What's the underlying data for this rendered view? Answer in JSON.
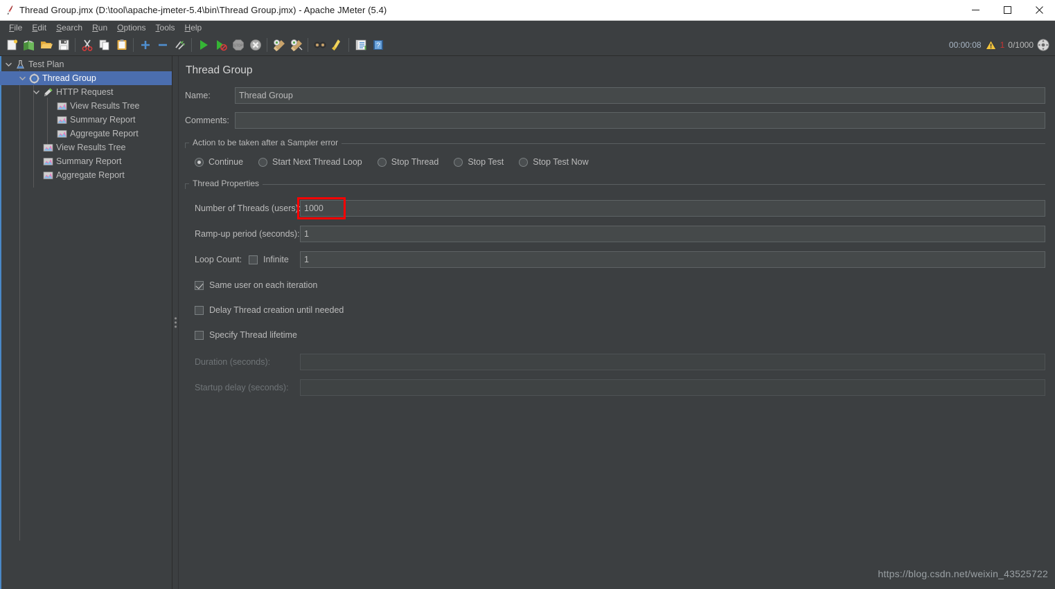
{
  "window": {
    "title": "Thread Group.jmx (D:\\tool\\apache-jmeter-5.4\\bin\\Thread Group.jmx) - Apache JMeter (5.4)",
    "app_icon": "jmeter-feather-icon",
    "minimize_label": "Minimize",
    "maximize_label": "Maximize",
    "close_label": "Close"
  },
  "menubar": {
    "items": [
      {
        "label": "File",
        "mnemonic": "F"
      },
      {
        "label": "Edit",
        "mnemonic": "E"
      },
      {
        "label": "Search",
        "mnemonic": "S"
      },
      {
        "label": "Run",
        "mnemonic": "R"
      },
      {
        "label": "Options",
        "mnemonic": "O"
      },
      {
        "label": "Tools",
        "mnemonic": "T"
      },
      {
        "label": "Help",
        "mnemonic": "H"
      }
    ]
  },
  "toolbar": {
    "buttons": [
      {
        "name": "new-icon",
        "tooltip": "New"
      },
      {
        "name": "templates-icon",
        "tooltip": "Templates"
      },
      {
        "name": "open-icon",
        "tooltip": "Open"
      },
      {
        "name": "save-icon",
        "tooltip": "Save Test Plan"
      },
      {
        "name": "cut-icon",
        "tooltip": "Cut"
      },
      {
        "name": "copy-icon",
        "tooltip": "Copy"
      },
      {
        "name": "paste-icon",
        "tooltip": "Paste"
      },
      {
        "name": "expand-all-icon",
        "tooltip": "Expand All"
      },
      {
        "name": "collapse-all-icon",
        "tooltip": "Collapse All"
      },
      {
        "name": "toggle-icon",
        "tooltip": "Toggle"
      },
      {
        "name": "start-icon",
        "tooltip": "Start"
      },
      {
        "name": "start-no-pause-icon",
        "tooltip": "Start no pauses"
      },
      {
        "name": "stop-icon",
        "tooltip": "Stop"
      },
      {
        "name": "shutdown-icon",
        "tooltip": "Shutdown"
      },
      {
        "name": "clear-icon",
        "tooltip": "Clear"
      },
      {
        "name": "clear-all-icon",
        "tooltip": "Clear All"
      },
      {
        "name": "search-icon",
        "tooltip": "Search"
      },
      {
        "name": "search-reset-icon",
        "tooltip": "Reset Search"
      },
      {
        "name": "function-helper-icon",
        "tooltip": "Function Helper Dialog"
      },
      {
        "name": "help-icon",
        "tooltip": "Help"
      }
    ],
    "status": {
      "elapsed": "00:00:08",
      "warning_icon": "warning-triangle-icon",
      "warning_count": "1",
      "threads": "0/1000",
      "remote_icon": "remote-engines-icon"
    }
  },
  "tree": {
    "nodes": [
      {
        "label": "Test Plan",
        "icon": "test-plan-icon",
        "depth": 0,
        "toggle": "expanded",
        "selected": false
      },
      {
        "label": "Thread Group",
        "icon": "thread-group-icon",
        "depth": 1,
        "toggle": "expanded",
        "selected": true
      },
      {
        "label": "HTTP Request",
        "icon": "http-request-icon",
        "depth": 2,
        "toggle": "expanded",
        "selected": false
      },
      {
        "label": "View Results Tree",
        "icon": "listener-icon",
        "depth": 3,
        "toggle": "none",
        "selected": false
      },
      {
        "label": "Summary Report",
        "icon": "listener-icon",
        "depth": 3,
        "toggle": "none",
        "selected": false
      },
      {
        "label": "Aggregate Report",
        "icon": "listener-icon",
        "depth": 3,
        "toggle": "none",
        "selected": false
      },
      {
        "label": "View Results Tree",
        "icon": "listener-icon",
        "depth": 2,
        "toggle": "none",
        "selected": false
      },
      {
        "label": "Summary Report",
        "icon": "listener-icon",
        "depth": 2,
        "toggle": "none",
        "selected": false
      },
      {
        "label": "Aggregate Report",
        "icon": "listener-icon",
        "depth": 2,
        "toggle": "none",
        "selected": false
      }
    ]
  },
  "panel": {
    "title": "Thread Group",
    "name_label": "Name:",
    "name_value": "Thread Group",
    "comments_label": "Comments:",
    "comments_value": "",
    "comments_placeholder": "",
    "error_action": {
      "group_title": "Action to be taken after a Sampler error",
      "options": [
        {
          "label": "Continue",
          "selected": true
        },
        {
          "label": "Start Next Thread Loop",
          "selected": false
        },
        {
          "label": "Stop Thread",
          "selected": false
        },
        {
          "label": "Stop Test",
          "selected": false
        },
        {
          "label": "Stop Test Now",
          "selected": false
        }
      ]
    },
    "thread_properties": {
      "group_title": "Thread Properties",
      "num_threads_label": "Number of Threads (users):",
      "num_threads_value": "1000",
      "rampup_label": "Ramp-up period (seconds):",
      "rampup_value": "1",
      "loop_count_label": "Loop Count:",
      "infinite_label": "Infinite",
      "infinite_checked": false,
      "loop_count_value": "1",
      "same_user_label": "Same user on each iteration",
      "same_user_checked": true,
      "delay_thread_label": "Delay Thread creation until needed",
      "delay_thread_checked": false,
      "specify_lifetime_label": "Specify Thread lifetime",
      "specify_lifetime_checked": false,
      "duration_label": "Duration (seconds):",
      "duration_value": "",
      "duration_disabled": true,
      "startup_delay_label": "Startup delay (seconds):",
      "startup_delay_value": "",
      "startup_delay_disabled": true
    }
  },
  "annotation": {
    "highlight_color": "#ff0000",
    "target": "num-threads-input"
  },
  "watermark": {
    "text": "https://blog.csdn.net/weixin_43525722"
  },
  "colors": {
    "background": "#3c3f41",
    "selection": "#4b6eaf",
    "text": "#bbbbbb",
    "field_bg": "#45494a",
    "titlebar_bg": "#ffffff"
  }
}
